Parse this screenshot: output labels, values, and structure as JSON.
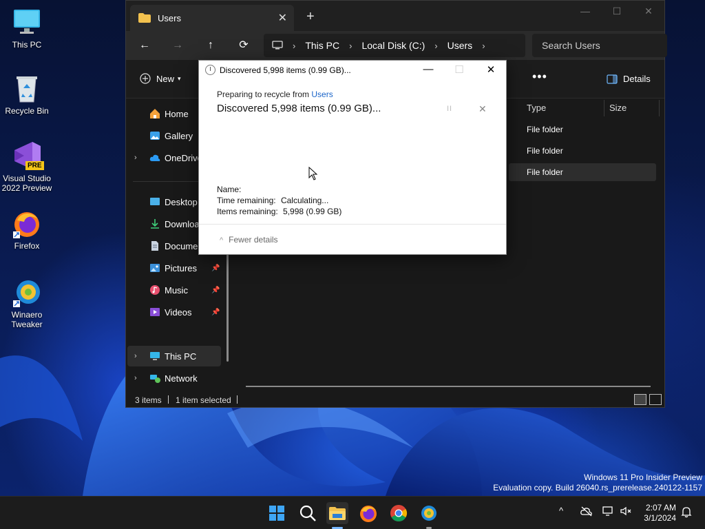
{
  "desktop": {
    "icons": [
      {
        "label": "This PC"
      },
      {
        "label": "Recycle Bin"
      },
      {
        "label": "Visual Studio 2022 Preview"
      },
      {
        "label": "Firefox"
      },
      {
        "label": "Winaero Tweaker"
      }
    ],
    "vs_badge": "PRE"
  },
  "explorer": {
    "tab_title": "Users",
    "tab_close": "✕",
    "new_tab": "+",
    "window_controls": {
      "minimize": "—",
      "maximize": "☐",
      "close": "✕"
    },
    "nav": {
      "back": "←",
      "forward": "→",
      "up": "↑",
      "refresh": "⟳"
    },
    "breadcrumb": [
      "This PC",
      "Local Disk (C:)",
      "Users"
    ],
    "breadcrumb_sep": "›",
    "search_placeholder": "Search Users",
    "toolbar": {
      "new_label": "New",
      "more": "•••",
      "details_label": "Details"
    },
    "sidebar": {
      "items": [
        {
          "label": "Home"
        },
        {
          "label": "Gallery"
        },
        {
          "label": "OneDrive"
        },
        {
          "label": "Desktop"
        },
        {
          "label": "Downloads"
        },
        {
          "label": "Documents"
        },
        {
          "label": "Pictures"
        },
        {
          "label": "Music"
        },
        {
          "label": "Videos"
        },
        {
          "label": "This PC"
        },
        {
          "label": "Network"
        }
      ]
    },
    "columns": {
      "type": "Type",
      "size": "Size"
    },
    "rows": [
      {
        "type": "File folder"
      },
      {
        "type": "File folder"
      },
      {
        "type": "File folder"
      }
    ],
    "status": {
      "count": "3 items",
      "selected": "1 item selected"
    }
  },
  "dialog": {
    "title": "Discovered 5,998 items (0.99 GB)...",
    "controls": {
      "minimize": "—",
      "maximize": "☐",
      "close": "✕"
    },
    "sub_prefix": "Preparing to recycle from ",
    "sub_link": "Users",
    "main": "Discovered 5,998 items (0.99 GB)...",
    "pause": "II",
    "cancel": "✕",
    "name_label": "Name:",
    "time_label": "Time remaining:",
    "time_value": "Calculating...",
    "items_label": "Items remaining:",
    "items_value": "5,998 (0.99 GB)",
    "fewer_details": "Fewer details",
    "fewer_chevron": "^"
  },
  "watermark": {
    "line1": "Windows 11 Pro Insider Preview",
    "line2": "Evaluation copy. Build 26040.rs_prerelease.240122-1157"
  },
  "taskbar": {
    "time": "2:07 AM",
    "date": "3/1/2024",
    "tray_chevron": "^"
  }
}
